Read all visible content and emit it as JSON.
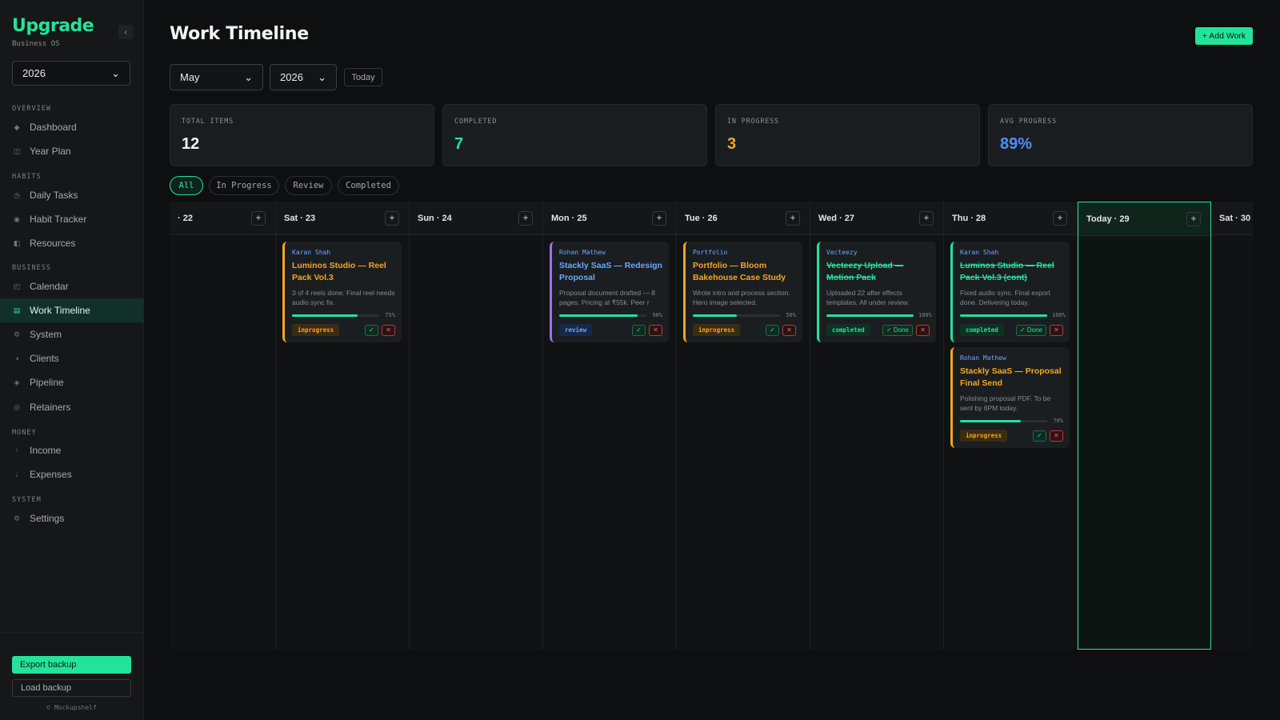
{
  "sidebar": {
    "brand": "Upgrade",
    "brand_sub": "Business OS",
    "collapse": "‹",
    "year": "2026",
    "sections": [
      {
        "label": "OVERVIEW"
      },
      {
        "label": "HABITS"
      },
      {
        "label": "BUSINESS"
      },
      {
        "label": "MONEY"
      },
      {
        "label": "SYSTEM"
      }
    ],
    "items": [
      {
        "label": "Dashboard",
        "icon": "diamond-icon",
        "glyph": "◆"
      },
      {
        "label": "Year Plan",
        "icon": "calendar-grid-icon",
        "glyph": "◫"
      },
      {
        "label": "Daily Tasks",
        "icon": "clock-icon",
        "glyph": "◷"
      },
      {
        "label": "Habit Tracker",
        "icon": "target-icon",
        "glyph": "◉"
      },
      {
        "label": "Resources",
        "icon": "book-icon",
        "glyph": "◧"
      },
      {
        "label": "Calendar",
        "icon": "calendar-icon",
        "glyph": "◰"
      },
      {
        "label": "Work Timeline",
        "icon": "timeline-icon",
        "glyph": "▤"
      },
      {
        "label": "System",
        "icon": "system-icon",
        "glyph": "⚙"
      },
      {
        "label": "Clients",
        "icon": "clients-icon",
        "glyph": "◑"
      },
      {
        "label": "Pipeline",
        "icon": "pipeline-icon",
        "glyph": "◈"
      },
      {
        "label": "Retainers",
        "icon": "retainer-icon",
        "glyph": "◎"
      },
      {
        "label": "Income",
        "icon": "arrow-up-icon",
        "glyph": "↑"
      },
      {
        "label": "Expenses",
        "icon": "arrow-down-icon",
        "glyph": "↓"
      },
      {
        "label": "Settings",
        "icon": "settings-icon",
        "glyph": "⚙"
      }
    ],
    "export_label": "Export backup",
    "load_label": "Load backup",
    "copyright": "© Mockupshelf"
  },
  "header": {
    "title": "Work Timeline",
    "add_label": "+ Add Work",
    "month": "May",
    "year": "2026",
    "today_label": "Today",
    "chevron": "⌄"
  },
  "stats": [
    {
      "label": "TOTAL ITEMS",
      "value": "12",
      "color": "#f2f4f5"
    },
    {
      "label": "COMPLETED",
      "value": "7",
      "color": "#22e39a"
    },
    {
      "label": "IN PROGRESS",
      "value": "3",
      "color": "#f5a524"
    },
    {
      "label": "AVG PROGRESS",
      "value": "89%",
      "color": "#4f8dff"
    }
  ],
  "filters": [
    "All",
    "In Progress",
    "Review",
    "Completed"
  ],
  "columns": [
    {
      "label": "· 22",
      "add": "+"
    },
    {
      "label": "Sat · 23",
      "add": "+"
    },
    {
      "label": "Sun · 24",
      "add": "+"
    },
    {
      "label": "Mon · 25",
      "add": "+"
    },
    {
      "label": "Tue · 26",
      "add": "+"
    },
    {
      "label": "Wed · 27",
      "add": "+"
    },
    {
      "label": "Thu · 28",
      "add": "+"
    },
    {
      "label": "Today · 29",
      "add": "+"
    },
    {
      "label": "Sat · 30",
      "add": "+"
    }
  ],
  "cards": [
    {
      "who": "Karan Shah",
      "title": "Luminos Studio — Reel Pack Vol.3",
      "desc": "3 of 4 reels done. Final reel needs audio sync fix.",
      "progress": 75,
      "pct": "75%",
      "status": "inprogress",
      "ok": "✓",
      "x": "✕",
      "accent": "#f5a524"
    },
    {
      "who": "Rohan Mathew",
      "title": "Stackly SaaS — Redesign Proposal",
      "desc": "Proposal document drafted — 8 pages. Pricing at ₹55k. Peer r",
      "progress": 90,
      "pct": "90%",
      "status": "review",
      "ok": "✓",
      "x": "✕",
      "accent": "#a06cff"
    },
    {
      "who": "Portfolio",
      "title": "Portfolio — Bloom Bakehouse Case Study",
      "desc": "Wrote intro and process section. Hero image selected.",
      "progress": 50,
      "pct": "50%",
      "status": "inprogress",
      "ok": "✓",
      "x": "✕",
      "accent": "#f5a524"
    },
    {
      "who": "Vecteezy",
      "title": "Vecteezy Upload — Motion Pack",
      "desc": "Uploaded 22 after effects templates. All under review.",
      "progress": 100,
      "pct": "100%",
      "status": "completed",
      "ok": "✓ Done",
      "x": "✕",
      "accent": "#22e39a"
    },
    {
      "who": "Karan Shah",
      "title": "Luminos Studio — Reel Pack Vol.3 (cont)",
      "desc": "Fixed audio sync. Final export done. Delivering today.",
      "progress": 100,
      "pct": "100%",
      "status": "completed",
      "ok": "✓ Done",
      "x": "✕",
      "accent": "#22e39a"
    },
    {
      "who": "Rohan Mathew",
      "title": "Stackly SaaS — Proposal Final Send",
      "desc": "Polishing proposal PDF. To be sent by 6PM today.",
      "progress": 70,
      "pct": "70%",
      "status": "inprogress",
      "ok": "✓",
      "x": "✕",
      "accent": "#f5a524"
    }
  ]
}
